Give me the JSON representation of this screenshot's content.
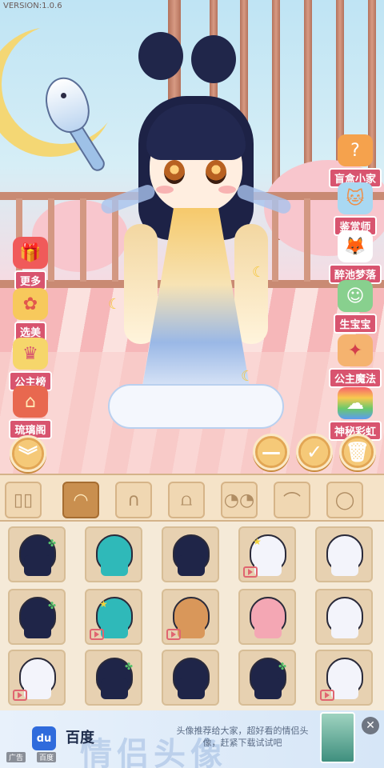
{
  "app": {
    "version": "VERSION:1.0.6"
  },
  "side_left": [
    {
      "label": "更多",
      "icon": "gift-box-icon"
    },
    {
      "label": "选美",
      "icon": "fan-icon"
    },
    {
      "label": "公主榜",
      "icon": "podium-icon"
    },
    {
      "label": "琉璃阁",
      "icon": "shop-icon"
    }
  ],
  "side_right": [
    {
      "label": "盲盒小家",
      "icon": "mystery-box-icon"
    },
    {
      "label": "鉴赏师",
      "icon": "cat-judge-icon"
    },
    {
      "label": "醉池梦落",
      "icon": "fox-mask-icon"
    },
    {
      "label": "生宝宝",
      "icon": "baby-icon"
    },
    {
      "label": "公主魔法",
      "icon": "princess-icon"
    },
    {
      "label": "神秘彩虹",
      "icon": "rainbow-icon"
    }
  ],
  "actions": {
    "collapse": "chevron-double-down-icon",
    "minus": "minus-icon",
    "confirm": "check-icon",
    "delete": "trash-icon"
  },
  "tabs": [
    {
      "name": "wardrobe",
      "icon": "wardrobe-icon",
      "active": false
    },
    {
      "name": "hair",
      "icon": "hair-icon",
      "active": true
    },
    {
      "name": "back-hair",
      "icon": "back-hair-icon",
      "active": false
    },
    {
      "name": "clothes",
      "icon": "clothes-icon",
      "active": false
    },
    {
      "name": "face",
      "icon": "face-icon",
      "active": false
    },
    {
      "name": "eyebrows",
      "icon": "eyebrows-icon",
      "active": false
    },
    {
      "name": "head",
      "icon": "head-icon",
      "active": false
    }
  ],
  "hair_items": [
    {
      "color": "#1f2548",
      "accent": "leaf",
      "video": false
    },
    {
      "color": "#2fb9b9",
      "accent": "none",
      "video": false
    },
    {
      "color": "#1f2548",
      "accent": "none",
      "video": false
    },
    {
      "color": "#f3f4fb",
      "accent": "star",
      "video": true
    },
    {
      "color": "#f3f4fb",
      "accent": "none",
      "video": false
    },
    {
      "color": "#1f2548",
      "accent": "leaf",
      "video": false
    },
    {
      "color": "#2fb9b9",
      "accent": "star",
      "video": true
    },
    {
      "color": "#d9975a",
      "accent": "none",
      "video": true
    },
    {
      "color": "#f4a7b4",
      "accent": "none",
      "video": false
    },
    {
      "color": "#f3f4fb",
      "accent": "none",
      "video": false
    },
    {
      "color": "#f3f4fb",
      "accent": "none",
      "video": true
    },
    {
      "color": "#1f2548",
      "accent": "leaf",
      "video": false
    },
    {
      "color": "#1f2548",
      "accent": "none",
      "video": false
    },
    {
      "color": "#1f2548",
      "accent": "leaf",
      "video": false
    },
    {
      "color": "#f3f4fb",
      "accent": "none",
      "video": true
    }
  ],
  "ad": {
    "logo": "du",
    "brand": "百度",
    "text": "头像推荐给大家，超好看的情侣头像，赶紧下载试试吧",
    "tag_ad": "广告",
    "tag_source": "百度",
    "close": "✕"
  }
}
